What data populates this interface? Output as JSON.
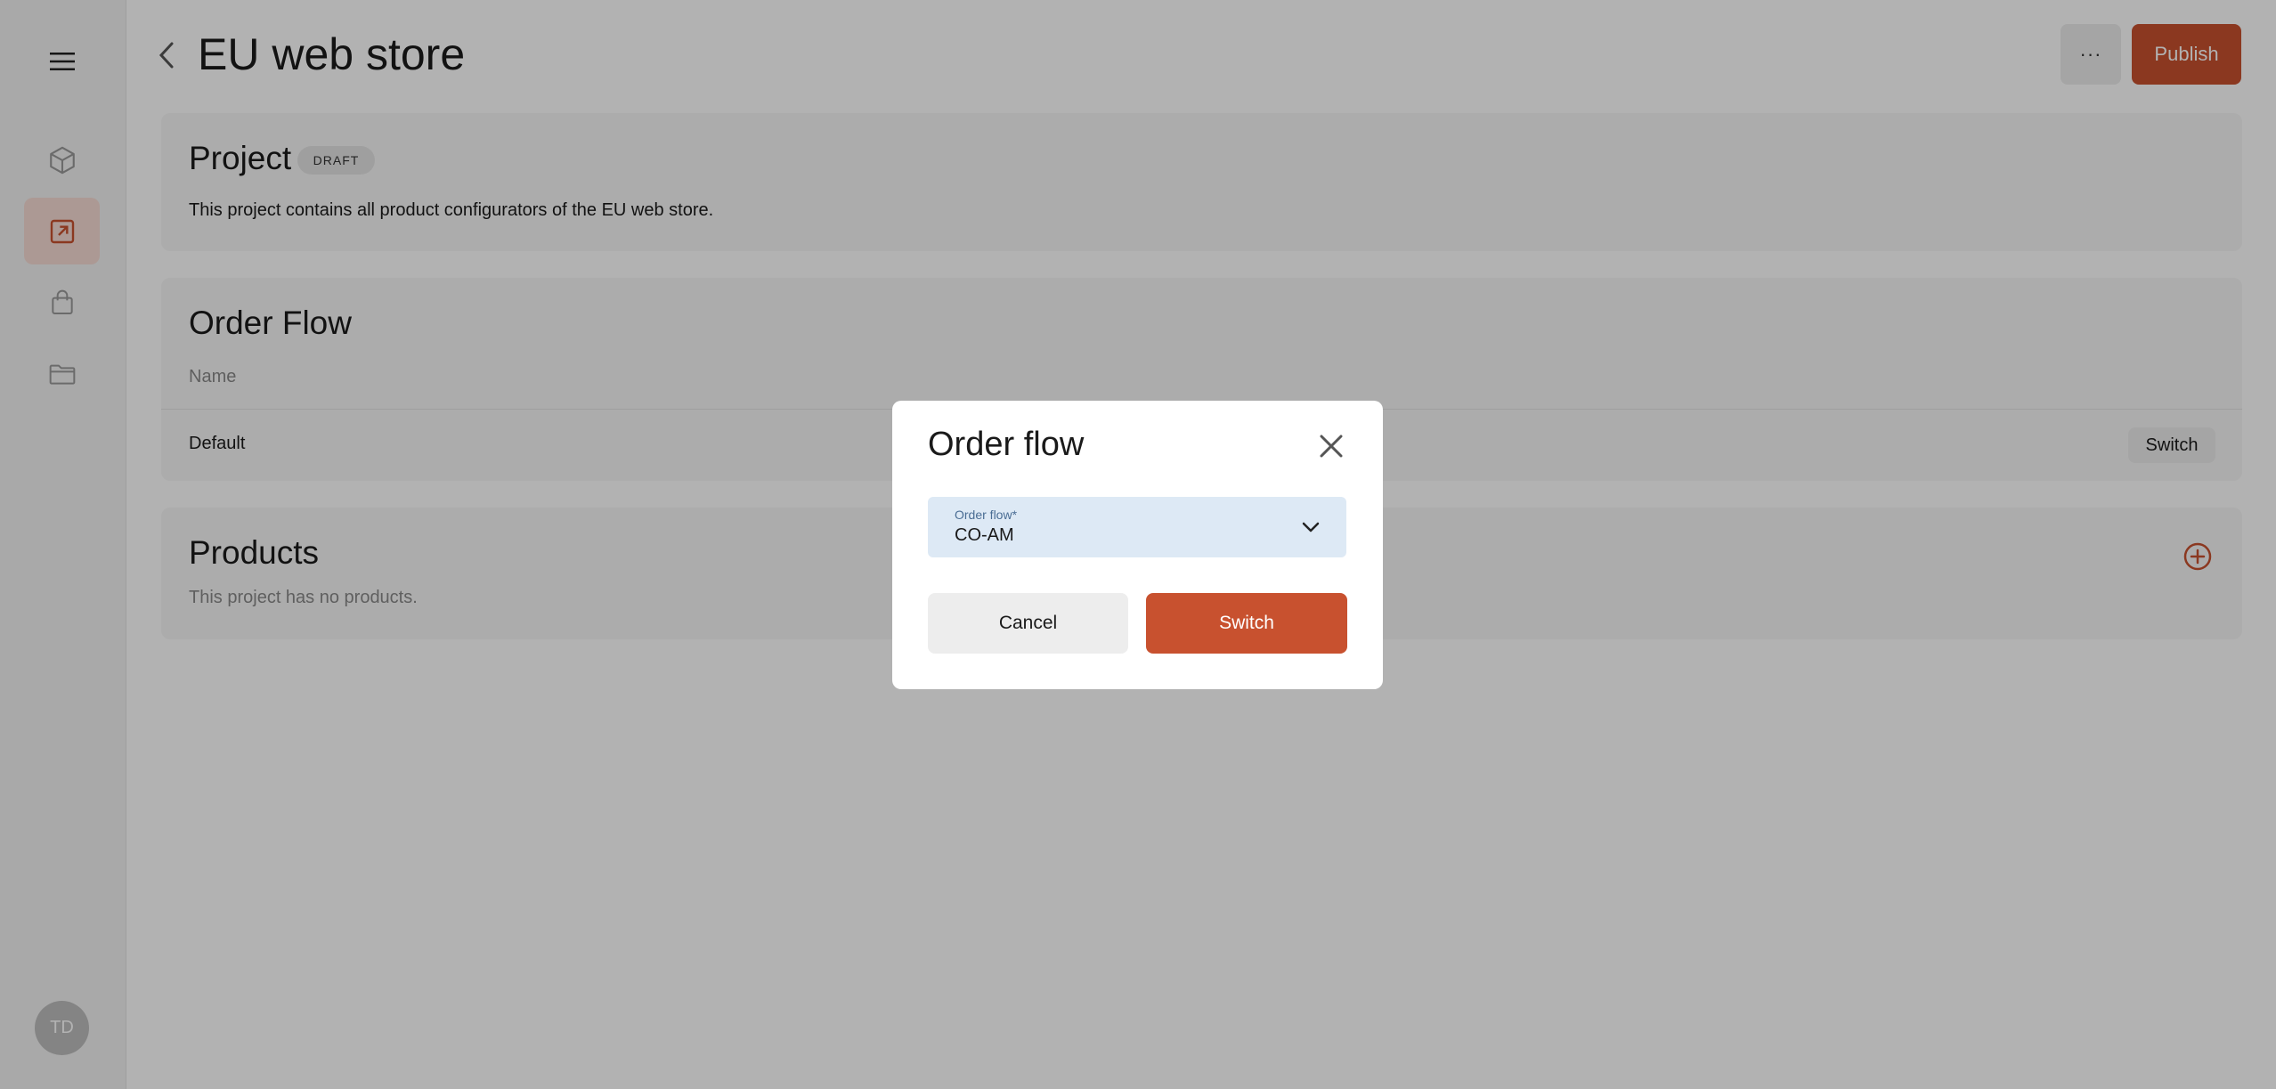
{
  "sidebar": {
    "items": [
      {
        "icon": "menu-icon"
      },
      {
        "icon": "cube-icon"
      },
      {
        "icon": "external-link-icon",
        "active": true
      },
      {
        "icon": "shopping-bag-icon"
      },
      {
        "icon": "folder-icon"
      }
    ],
    "avatar_initials": "TD"
  },
  "header": {
    "title": "EU web store",
    "more_label": "···",
    "publish_label": "Publish"
  },
  "project": {
    "title": "Project",
    "badge": "DRAFT",
    "description": "This project contains all product configurators of the EU web store."
  },
  "order_flow": {
    "title": "Order Flow",
    "column_header": "Name",
    "rows": [
      {
        "name": "Default",
        "action_label": "Switch"
      }
    ]
  },
  "products": {
    "title": "Products",
    "empty_text": "This project has no products."
  },
  "modal": {
    "title": "Order flow",
    "select_label": "Order flow*",
    "select_value": "CO-AM",
    "cancel_label": "Cancel",
    "switch_label": "Switch"
  },
  "colors": {
    "accent": "#c8512f",
    "select_bg": "#dde9f5"
  }
}
